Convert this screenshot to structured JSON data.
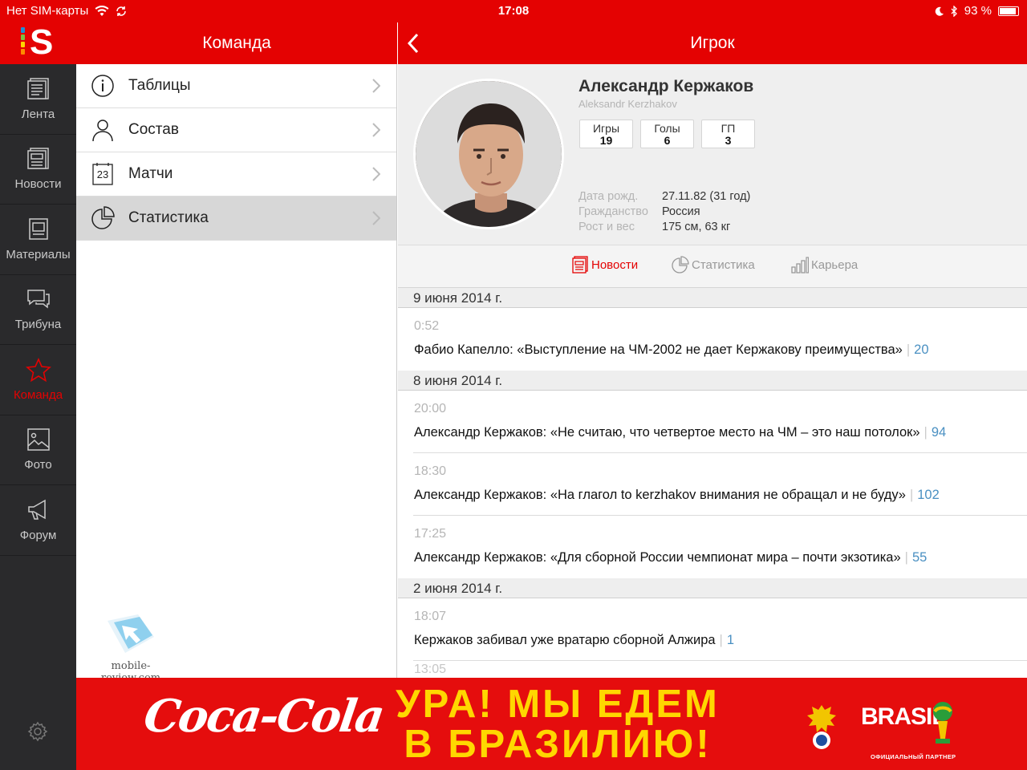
{
  "status_bar": {
    "carrier": "Нет SIM-карты",
    "time": "17:08",
    "battery": "93 %"
  },
  "sidebar": {
    "logo_letter": "S",
    "items": [
      {
        "label": "Лента",
        "icon": "feed-icon",
        "active": false
      },
      {
        "label": "Новости",
        "icon": "news-icon",
        "active": false
      },
      {
        "label": "Материалы",
        "icon": "materials-icon",
        "active": false
      },
      {
        "label": "Трибуна",
        "icon": "chat-icon",
        "active": false
      },
      {
        "label": "Команда",
        "icon": "star-icon",
        "active": true
      },
      {
        "label": "Фото",
        "icon": "photo-icon",
        "active": false
      },
      {
        "label": "Форум",
        "icon": "megaphone-icon",
        "active": false
      }
    ],
    "settings_icon": "gear-icon"
  },
  "team_panel": {
    "title": "Команда",
    "menu": [
      {
        "label": "Таблицы",
        "icon": "info-icon"
      },
      {
        "label": "Состав",
        "icon": "person-icon"
      },
      {
        "label": "Матчи",
        "icon": "calendar-icon",
        "icon_text": "23"
      },
      {
        "label": "Статистика",
        "icon": "pie-chart-icon",
        "active": true
      }
    ],
    "watermark": "mobile-review.com"
  },
  "player_panel": {
    "title": "Игрок",
    "name": "Александр Кержаков",
    "latin_name": "Aleksandr Kerzhakov",
    "stats": [
      {
        "label": "Игры",
        "value": "19"
      },
      {
        "label": "Голы",
        "value": "6"
      },
      {
        "label": "ГП",
        "value": "3"
      }
    ],
    "info": [
      {
        "key": "Дата рожд.",
        "value": "27.11.82 (31 год)"
      },
      {
        "key": "Гражданство",
        "value": "Россия"
      },
      {
        "key": "Рост и вес",
        "value": "175 см, 63 кг"
      }
    ],
    "tabs": [
      {
        "label": "Новости",
        "icon": "news-icon",
        "active": true
      },
      {
        "label": "Статистика",
        "icon": "pie-chart-icon"
      },
      {
        "label": "Карьера",
        "icon": "bar-chart-icon"
      }
    ],
    "feed": [
      {
        "date": "9 июня 2014 г.",
        "items": [
          {
            "time": "0:52",
            "title": "Фабио Капелло: «Выступление на ЧМ-2002 не дает Кержакову преимущества»",
            "count": "20"
          }
        ]
      },
      {
        "date": "8 июня 2014 г.",
        "items": [
          {
            "time": "20:00",
            "title": "Александр Кержаков: «Не считаю, что четвертое место на ЧМ – это наш потолок»",
            "count": "94"
          },
          {
            "time": "18:30",
            "title": "Александр Кержаков: «На глагол to kerzhakov внимания не обращал и не буду»",
            "count": "102"
          },
          {
            "time": "17:25",
            "title": "Александр Кержаков: «Для сборной России чемпионат мира – почти экзотика»",
            "count": "55"
          }
        ]
      },
      {
        "date": "2 июня 2014 г.",
        "items": [
          {
            "time": "18:07",
            "title": "Кержаков забивал уже вратарю сборной Алжира",
            "count": "1"
          }
        ]
      }
    ],
    "partial_time": "13:05"
  },
  "banner": {
    "brand": "Coca-Cola",
    "slogan_line1": "УРА! МЫ ЕДЕМ",
    "slogan_line2": "В БРАЗИЛИЮ!",
    "brasil": "BRASIL",
    "partner": "ОФИЦИАЛЬНЫЙ ПАРТНЕР",
    "colors": {
      "red": "#e50d0d",
      "yellow": "#ffd700"
    }
  }
}
